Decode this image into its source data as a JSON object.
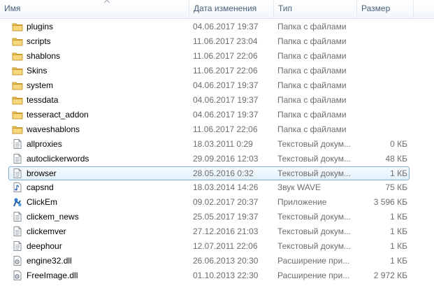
{
  "columns": {
    "name": "Имя",
    "date": "Дата изменения",
    "type": "Тип",
    "size": "Размер"
  },
  "files": [
    {
      "name": "plugins",
      "date": "04.06.2017 19:37",
      "type": "Папка с файлами",
      "size": "",
      "icon": "folder-icon"
    },
    {
      "name": "scripts",
      "date": "11.06.2017 23:04",
      "type": "Папка с файлами",
      "size": "",
      "icon": "folder-icon"
    },
    {
      "name": "shablons",
      "date": "11.06.2017 22:06",
      "type": "Папка с файлами",
      "size": "",
      "icon": "folder-icon"
    },
    {
      "name": "Skins",
      "date": "11.06.2017 22:06",
      "type": "Папка с файлами",
      "size": "",
      "icon": "folder-icon"
    },
    {
      "name": "system",
      "date": "04.06.2017 19:37",
      "type": "Папка с файлами",
      "size": "",
      "icon": "folder-icon"
    },
    {
      "name": "tessdata",
      "date": "04.06.2017 19:37",
      "type": "Папка с файлами",
      "size": "",
      "icon": "folder-icon"
    },
    {
      "name": "tesseract_addon",
      "date": "04.06.2017 19:37",
      "type": "Папка с файлами",
      "size": "",
      "icon": "folder-icon"
    },
    {
      "name": "waveshablons",
      "date": "11.06.2017 22:06",
      "type": "Папка с файлами",
      "size": "",
      "icon": "folder-icon"
    },
    {
      "name": "allproxies",
      "date": "18.03.2011 0:29",
      "type": "Текстовый докум...",
      "size": "0 КБ",
      "icon": "text-file-icon"
    },
    {
      "name": "autoclickerwords",
      "date": "29.09.2016 12:03",
      "type": "Текстовый докум...",
      "size": "48 КБ",
      "icon": "text-file-icon"
    },
    {
      "name": "browser",
      "date": "28.05.2016 0:32",
      "type": "Текстовый докум...",
      "size": "1 КБ",
      "icon": "text-file-icon",
      "selected": true
    },
    {
      "name": "capsnd",
      "date": "18.03.2014 14:26",
      "type": "Звук WAVE",
      "size": "75 КБ",
      "icon": "audio-file-icon"
    },
    {
      "name": "ClickEm",
      "date": "09.02.2017 20:37",
      "type": "Приложение",
      "size": "3 596 КБ",
      "icon": "app-icon"
    },
    {
      "name": "clickem_news",
      "date": "25.05.2017 19:37",
      "type": "Текстовый докум...",
      "size": "1 КБ",
      "icon": "text-file-icon"
    },
    {
      "name": "clickemver",
      "date": "27.12.2016 21:03",
      "type": "Текстовый докум...",
      "size": "1 КБ",
      "icon": "text-file-icon"
    },
    {
      "name": "deephour",
      "date": "12.07.2011 22:06",
      "type": "Текстовый докум...",
      "size": "1 КБ",
      "icon": "text-file-icon"
    },
    {
      "name": "engine32.dll",
      "date": "26.06.2013 20:30",
      "type": "Расширение при...",
      "size": "1 КБ",
      "icon": "dll-file-icon"
    },
    {
      "name": "FreeImage.dll",
      "date": "01.10.2013 22:30",
      "type": "Расширение при...",
      "size": "2 972 КБ",
      "icon": "dll-file-icon"
    }
  ]
}
